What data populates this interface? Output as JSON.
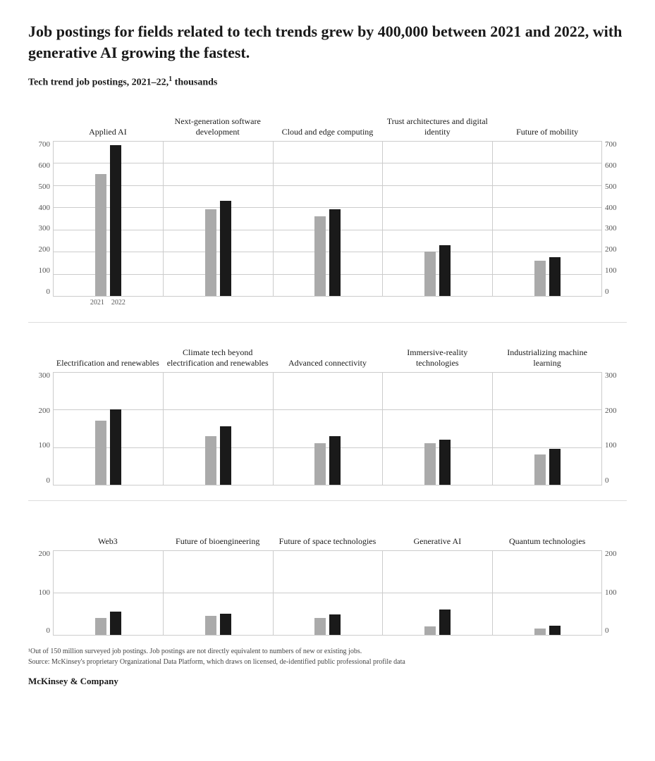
{
  "title": "Job postings for fields related to tech trends grew by 400,000 between 2021 and 2022, with generative AI growing the fastest.",
  "subtitle": "Tech trend job postings, 2021–22,",
  "subtitle_sup": "1",
  "subtitle_unit": " thousands",
  "rows": [
    {
      "y_max": 700,
      "y_ticks": [
        700,
        600,
        500,
        400,
        300,
        200,
        100,
        0
      ],
      "charts": [
        {
          "label": "Applied AI",
          "val_2021": 550,
          "val_2022": 680,
          "show_x": true
        },
        {
          "label": "Next-generation software development",
          "val_2021": 390,
          "val_2022": 430
        },
        {
          "label": "Cloud and edge computing",
          "val_2021": 360,
          "val_2022": 390
        },
        {
          "label": "Trust architectures and digital identity",
          "val_2021": 200,
          "val_2022": 230
        },
        {
          "label": "Future of mobility",
          "val_2021": 160,
          "val_2022": 175
        }
      ]
    },
    {
      "y_max": 300,
      "y_ticks": [
        300,
        200,
        100,
        0
      ],
      "charts": [
        {
          "label": "Electrification and renewables",
          "val_2021": 170,
          "val_2022": 200
        },
        {
          "label": "Climate tech beyond electrification and renewables",
          "val_2021": 130,
          "val_2022": 155
        },
        {
          "label": "Advanced connectivity",
          "val_2021": 110,
          "val_2022": 130
        },
        {
          "label": "Immersive-reality technologies",
          "val_2021": 110,
          "val_2022": 120
        },
        {
          "label": "Industrializing machine learning",
          "val_2021": 80,
          "val_2022": 95
        }
      ]
    },
    {
      "y_max": 200,
      "y_ticks": [
        200,
        100,
        0
      ],
      "charts": [
        {
          "label": "Web3",
          "val_2021": 40,
          "val_2022": 55
        },
        {
          "label": "Future of bioengineering",
          "val_2021": 45,
          "val_2022": 50
        },
        {
          "label": "Future of space technologies",
          "val_2021": 40,
          "val_2022": 48
        },
        {
          "label": "Generative AI",
          "val_2021": 20,
          "val_2022": 60
        },
        {
          "label": "Quantum technologies",
          "val_2021": 15,
          "val_2022": 22
        }
      ]
    }
  ],
  "x_labels": [
    "2021",
    "2022"
  ],
  "footnote_1": "¹Out of 150 million surveyed job postings. Job postings are not directly equivalent to numbers of new or existing jobs.",
  "footnote_2": "Source: McKinsey's proprietary Organizational Data Platform, which draws on licensed, de-identified public professional profile data",
  "brand": "McKinsey & Company"
}
